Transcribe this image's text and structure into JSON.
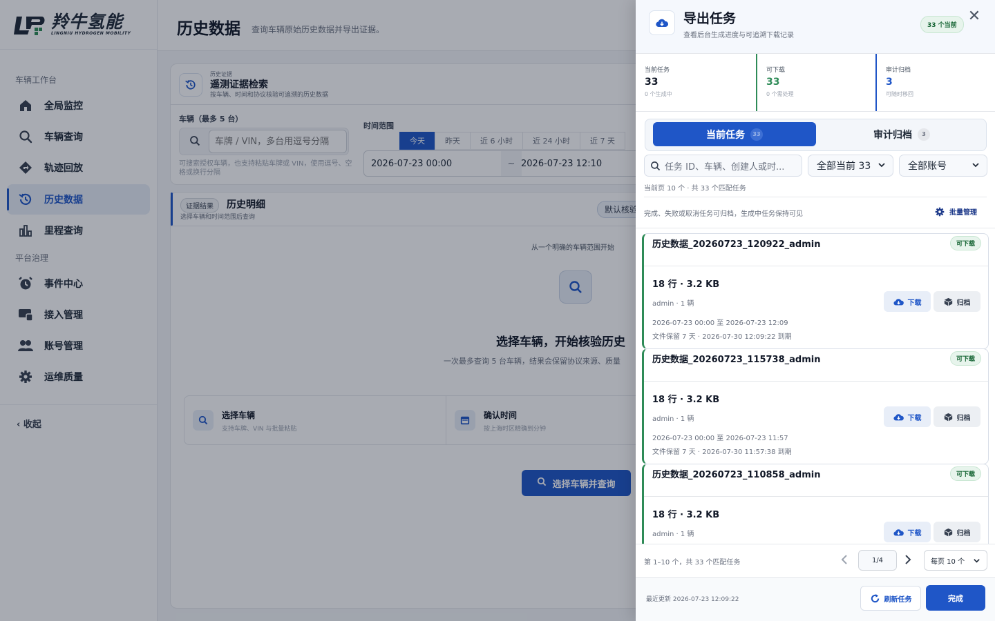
{
  "brand": {
    "name_cn": "羚牛氢能",
    "name_en": "LINGNIU HYDROGEN MOBILITY"
  },
  "sidebar": {
    "group1": "车辆工作台",
    "group2": "平台治理",
    "items": [
      {
        "label": "全局监控",
        "icon": "home-icon"
      },
      {
        "label": "车辆查询",
        "icon": "search-icon"
      },
      {
        "label": "轨迹回放",
        "icon": "route-icon"
      },
      {
        "label": "历史数据",
        "icon": "history-icon",
        "active": true
      },
      {
        "label": "里程查询",
        "icon": "bar-chart-icon"
      },
      {
        "label": "事件中心",
        "icon": "alarm-clock-icon"
      },
      {
        "label": "接入管理",
        "icon": "access-icon"
      },
      {
        "label": "账号管理",
        "icon": "users-icon"
      },
      {
        "label": "运维质量",
        "icon": "gear-icon"
      }
    ],
    "collapse": "收起"
  },
  "main": {
    "title": "历史数据",
    "subtitle": "查询车辆原始历史数据并导出证据。",
    "search_card": {
      "eyebrow": "历史证据",
      "title": "遥测证据检索",
      "desc": "按车辆、时间和协议核验可追溯的历史数据",
      "vehicle_label": "车辆（最多 5 台）",
      "vehicle_placeholder": "车牌 / VIN，多台用逗号分隔",
      "vehicle_hint1": "可搜索授权车辆，也支持粘贴车牌或 VIN，使用逗号、空",
      "vehicle_hint2": "格或换行分隔",
      "time_label": "时间范围",
      "time_presets": [
        "今天",
        "昨天",
        "近 6 小时",
        "近 24 小时",
        "近 7 天"
      ],
      "start": "2026-07-23 00:00",
      "tilde": "~",
      "end": "2026-07-23 12:10"
    },
    "result_card": {
      "tag": "证据结果",
      "title": "历史明细",
      "desc": "选择车辆和时间范围后查询",
      "default_chip": "默认核验",
      "empty_eyebrow": "从一个明确的车辆范围开始",
      "empty_title": "选择车辆，开始核验历史",
      "empty_desc": "一次最多查询 5 台车辆，结果会保留协议来源、质量",
      "step1_title": "选择车辆",
      "step1_desc": "支持车牌、VIN 与批量粘贴",
      "step2_title": "确认时间",
      "step2_desc": "按上海时区精确到分钟",
      "cta": "选择车辆并查询"
    }
  },
  "drawer": {
    "title": "导出任务",
    "subtitle": "查看后台生成进度与可追溯下载记录",
    "current_badge": "33 个当前",
    "stats": [
      {
        "key": "当前任务",
        "value": "33",
        "note": "0 个生成中",
        "color": "#111827"
      },
      {
        "key": "可下载",
        "value": "33",
        "note": "0 个需处理",
        "color": "#2e8b57"
      },
      {
        "key": "审计归档",
        "value": "3",
        "note": "可随时移回",
        "color": "#1f56c7"
      }
    ],
    "tabs": [
      {
        "label": "当前任务",
        "count": "33"
      },
      {
        "label": "审计归档",
        "count": "3"
      }
    ],
    "search_placeholder": "任务 ID、车辆、创建人或时...",
    "status_filter": "全部当前 33",
    "account_filter": "全部账号",
    "page_meta": "当前页 10 个 · 共 33 个匹配任务",
    "archive_hint": "完成、失败或取消任务可归档，生成中任务保持可见",
    "batch_manage": "批量管理",
    "download_label": "下载",
    "archive_label": "归档",
    "tasks": [
      {
        "name": "历史数据_20260723_120922_admin",
        "status": "可下载",
        "rows": "18 行 · 3.2 KB",
        "who": "admin · 1 辆",
        "range": "2026-07-23 00:00 至 2026-07-23 12:09",
        "keep": "文件保留 7 天 · 2026-07-30 12:09:22 到期"
      },
      {
        "name": "历史数据_20260723_115738_admin",
        "status": "可下载",
        "rows": "18 行 · 3.2 KB",
        "who": "admin · 1 辆",
        "range": "2026-07-23 00:00 至 2026-07-23 11:57",
        "keep": "文件保留 7 天 · 2026-07-30 11:57:38 到期"
      },
      {
        "name": "历史数据_20260723_110858_admin",
        "status": "可下载",
        "rows": "18 行 · 3.2 KB",
        "who": "admin · 1 辆",
        "range": "",
        "keep": ""
      }
    ],
    "pager_summary": "第 1–10 个，共 33 个匹配任务",
    "pager_page": "1/4",
    "page_size": "每页 10 个",
    "last_update": "最近更新 2026-07-23 12:09:22",
    "refresh": "刷新任务",
    "done": "完成"
  }
}
